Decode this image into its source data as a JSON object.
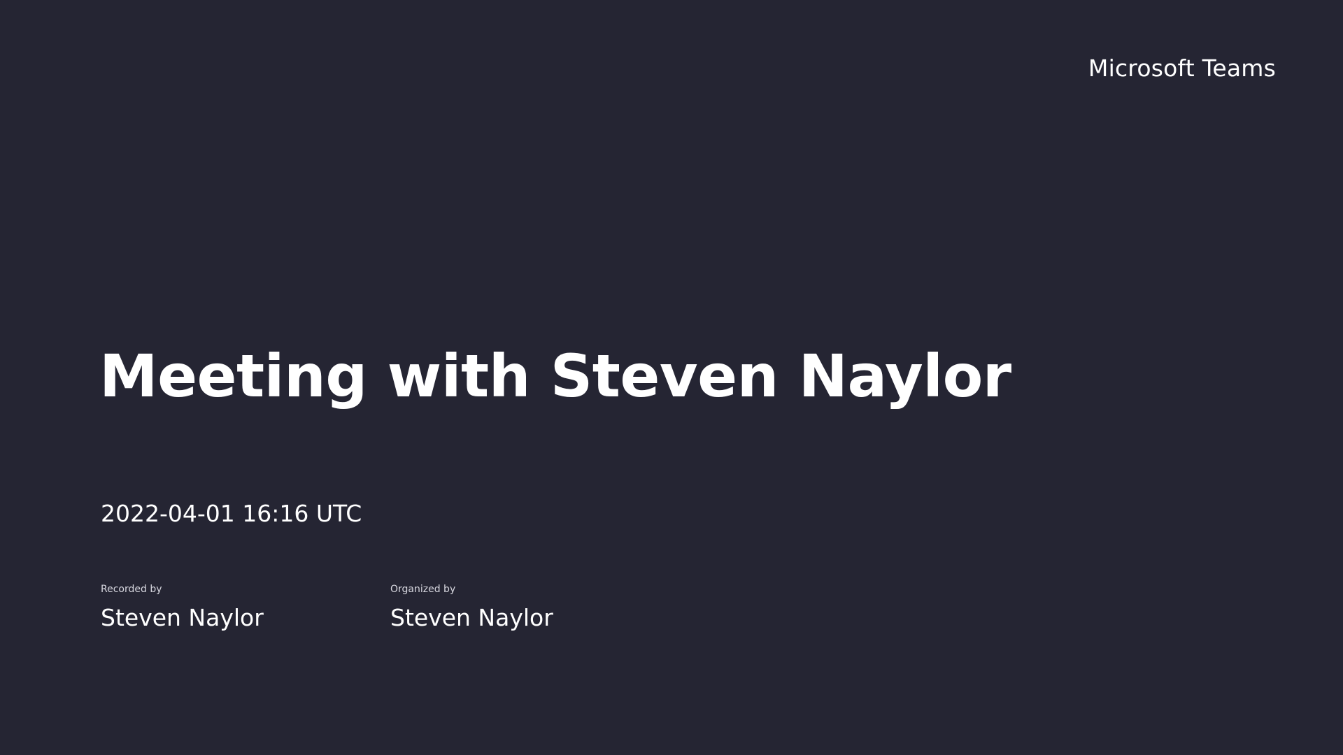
{
  "brand": {
    "label": "Microsoft Teams"
  },
  "meeting": {
    "title": "Meeting with Steven Naylor",
    "datetime": "2022-04-01 16:16 UTC",
    "recorded_by": {
      "label": "Recorded by",
      "value": "Steven Naylor"
    },
    "organized_by": {
      "label": "Organized by",
      "value": "Steven Naylor"
    }
  },
  "colors": {
    "background": "#252533",
    "text": "#ffffff"
  }
}
